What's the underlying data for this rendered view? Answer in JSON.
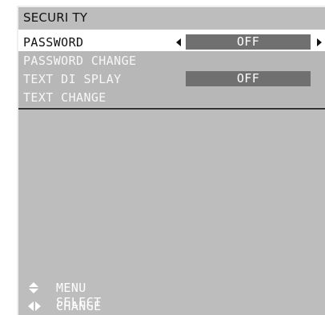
{
  "menu": {
    "title": "SECURI TY",
    "items": [
      {
        "label": "PASSWORD",
        "value": "OFF"
      },
      {
        "label": "PASSWORD CHANGE"
      },
      {
        "label": "TEXT DI SPLAY",
        "value": "OFF"
      },
      {
        "label": "TEXT CHANGE"
      }
    ]
  },
  "footer": {
    "menu_select": {
      "icon": "up-down-arrows-icon",
      "label": "MENU SELECT"
    },
    "change": {
      "icon": "left-right-arrows-icon",
      "label": "CHANGE"
    }
  },
  "colors": {
    "panel": "#bdbdbd",
    "selected_row": "#ffffff",
    "value_box": "#707070",
    "text_dim": "#f7f7f7"
  }
}
